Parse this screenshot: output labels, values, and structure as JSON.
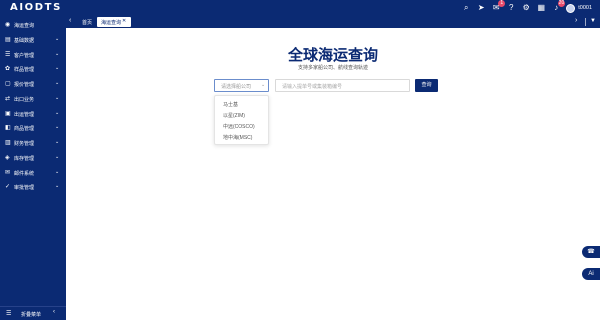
{
  "app": {
    "logo": "AIODTS"
  },
  "topbar": {
    "icons": [
      {
        "name": "search-icon",
        "glyph": "⌕"
      },
      {
        "name": "send-icon",
        "glyph": "➤"
      },
      {
        "name": "message-icon",
        "glyph": "✉",
        "badge": "1"
      },
      {
        "name": "help-icon",
        "glyph": "?"
      },
      {
        "name": "settings-icon",
        "glyph": "⚙"
      },
      {
        "name": "grid-icon",
        "glyph": "▦"
      },
      {
        "name": "bell-icon",
        "glyph": "♪",
        "badge": "20"
      }
    ],
    "username": "t0001"
  },
  "sidebar": {
    "items": [
      {
        "label": "海运查询",
        "icon": "ship-icon",
        "glyph": "◉",
        "chevron": false
      },
      {
        "label": "基础数据",
        "icon": "database-icon",
        "glyph": "▤",
        "chevron": true
      },
      {
        "label": "客户管理",
        "icon": "customer-icon",
        "glyph": "☰",
        "chevron": true
      },
      {
        "label": "样品管理",
        "icon": "sample-icon",
        "glyph": "✿",
        "chevron": true
      },
      {
        "label": "报价管理",
        "icon": "quote-icon",
        "glyph": "▢",
        "chevron": true
      },
      {
        "label": "出口业务",
        "icon": "export-icon",
        "glyph": "⇄",
        "chevron": true
      },
      {
        "label": "出运管理",
        "icon": "shipment-icon",
        "glyph": "▣",
        "chevron": true
      },
      {
        "label": "商品管理",
        "icon": "goods-icon",
        "glyph": "◧",
        "chevron": true
      },
      {
        "label": "财务管理",
        "icon": "finance-icon",
        "glyph": "▥",
        "chevron": true
      },
      {
        "label": "库存管理",
        "icon": "inventory-icon",
        "glyph": "◈",
        "chevron": true
      },
      {
        "label": "邮件系统",
        "icon": "mail-icon",
        "glyph": "✉",
        "chevron": true
      },
      {
        "label": "审批管理",
        "icon": "approval-icon",
        "glyph": "✓",
        "chevron": true
      }
    ],
    "bottom_label": "折叠菜单"
  },
  "tabs": {
    "home": "首页",
    "active": "海运查询"
  },
  "main": {
    "title": "全球海运查询",
    "subtitle": "支持多家船公司、航线查询轨迹",
    "select_placeholder": "请选择船公司",
    "input_placeholder": "请输入提单号或集装箱编号",
    "search_button": "查询",
    "options": [
      "马士基",
      "以星(ZIM)",
      "中远(COSCO)",
      "地中海(MSC)"
    ]
  },
  "floating": {
    "top_label": "",
    "ai_label": "Ai"
  },
  "colors": {
    "primary": "#0b2a73",
    "badge": "#e74a6b"
  }
}
